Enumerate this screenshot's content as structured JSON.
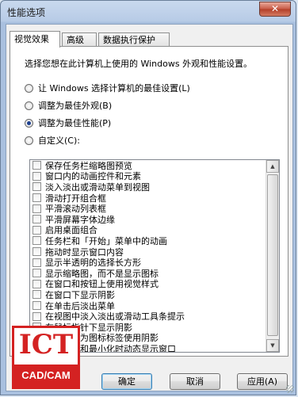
{
  "window": {
    "title": "性能选项",
    "close_symbol": "✕"
  },
  "tabs": [
    {
      "label": "视觉效果",
      "active": true
    },
    {
      "label": "高级",
      "active": false
    },
    {
      "label": "数据执行保护",
      "active": false
    }
  ],
  "panel": {
    "intro": "选择您想在此计算机上使用的 Windows 外观和性能设置。",
    "radios": [
      {
        "label": "让 Windows 选择计算机的最佳设置(L)",
        "selected": false
      },
      {
        "label": "调整为最佳外观(B)",
        "selected": false
      },
      {
        "label": "调整为最佳性能(P)",
        "selected": true
      },
      {
        "label": "自定义(C):",
        "selected": false
      }
    ],
    "options": [
      "保存任务栏缩略图预览",
      "窗口内的动画控件和元素",
      "淡入淡出或滑动菜单到视图",
      "滑动打开组合框",
      "平滑滚动列表框",
      "平滑屏幕字体边缘",
      "启用桌面组合",
      "任务栏和「开始」菜单中的动画",
      "拖动时显示窗口内容",
      "显示半透明的选择长方形",
      "显示缩略图，而不是显示图标",
      "在窗口和按钮上使用视觉样式",
      "在窗口下显示阴影",
      "在单击后淡出菜单",
      "在视图中淡入淡出或滑动工具条提示",
      "在鼠标指针下显示阴影",
      "在桌面上为图标标签使用阴影",
      "在最大化和最小化时动态显示窗口"
    ]
  },
  "buttons": {
    "ok": "确定",
    "cancel": "取消",
    "apply": "应用(A)"
  },
  "watermark": {
    "main": "ICT",
    "sub": "CAD/CAM"
  },
  "colors": {
    "accent": "#d42222",
    "selected_radio": "#1c3f8f"
  }
}
